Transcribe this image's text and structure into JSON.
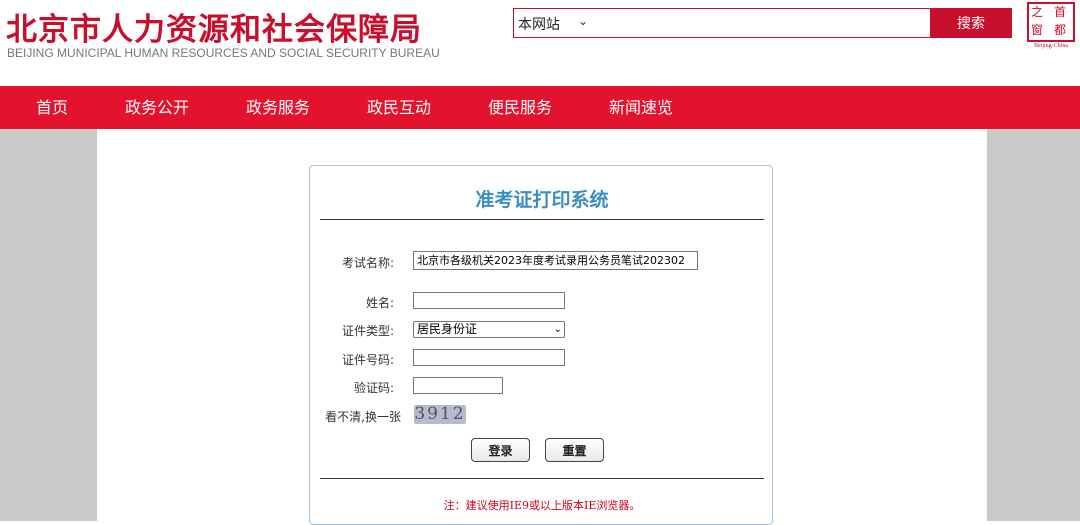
{
  "header": {
    "title": "北京市人力资源和社会保障局",
    "subtitle": "BEIJING MUNICIPAL HUMAN RESOURCES AND SOCIAL SECURITY BUREAU",
    "search_scope": "本网站",
    "search_button": "搜索",
    "seal_chars": [
      "之",
      "首",
      "窗",
      "都"
    ],
    "seal_caption": "Beijing-China",
    "scope_icon": "chevron-down-icon"
  },
  "nav": {
    "items": [
      {
        "label": "首页"
      },
      {
        "label": "政务公开"
      },
      {
        "label": "政务服务"
      },
      {
        "label": "政民互动"
      },
      {
        "label": "便民服务"
      },
      {
        "label": "新闻速览"
      }
    ]
  },
  "form": {
    "title": "准考证打印系统",
    "exam_name_label": "考试名称:",
    "exam_name_value": "北京市各级机关2023年度考试录用公务员笔试202302",
    "name_label": "姓名:",
    "name_value": "",
    "id_type_label": "证件类型:",
    "id_type_value": "居民身份证",
    "id_number_label": "证件号码:",
    "id_number_value": "",
    "captcha_label": "验证码:",
    "captcha_value": "",
    "refresh_label": "看不清,换一张",
    "captcha_text": "3912",
    "login_button": "登录",
    "reset_button": "重置",
    "note": "注：建议使用IE9或以上版本IE浏览器。"
  },
  "colors": {
    "brand_red": "#c8102e",
    "nav_red": "#e3132d",
    "title_blue": "#3a8fc2",
    "page_gray": "#c9c9c9"
  }
}
